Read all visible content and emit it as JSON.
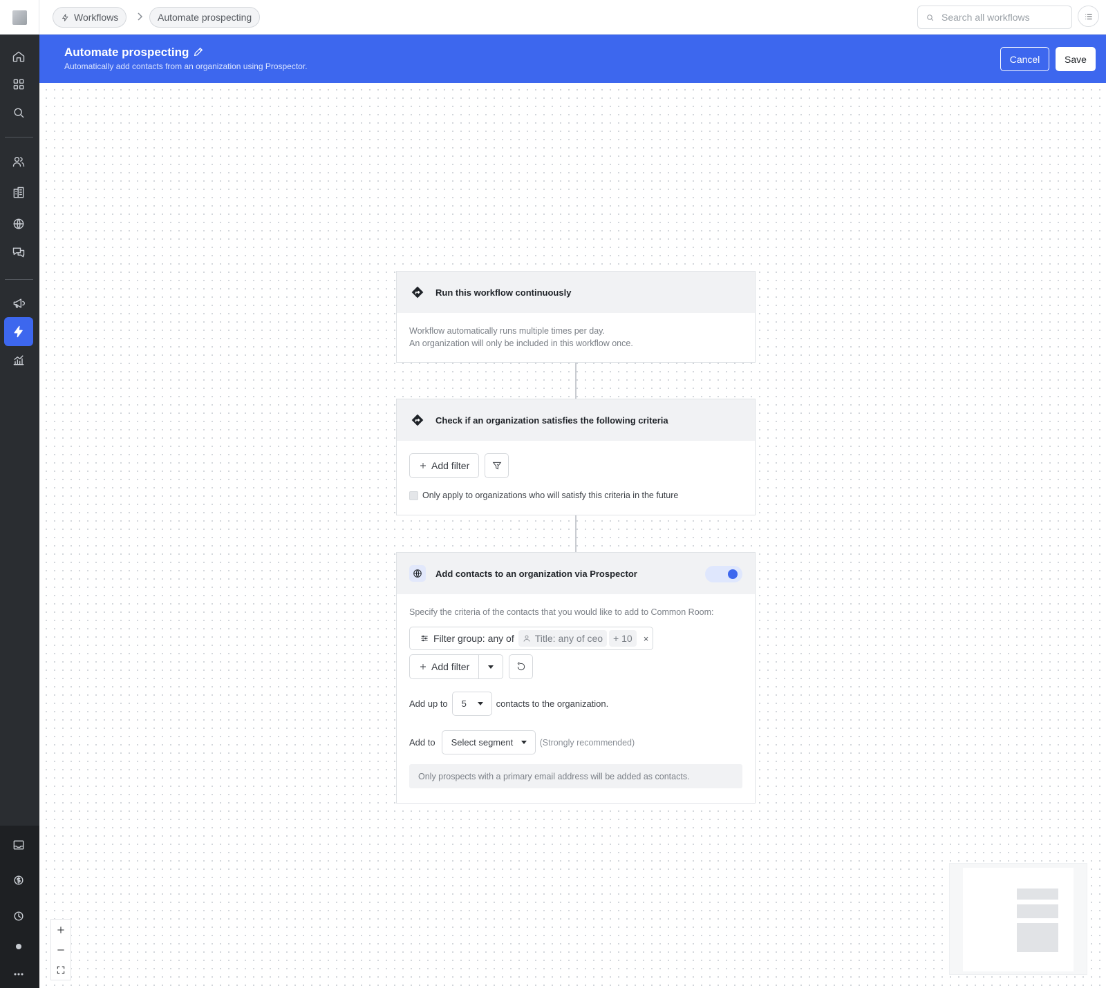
{
  "topbar": {
    "breadcrumbs": [
      {
        "label": "Workflows",
        "icon": "bolt-icon"
      },
      {
        "label": "Automate prospecting"
      }
    ],
    "search_placeholder": "Search all workflows"
  },
  "banner": {
    "title": "Automate prospecting",
    "subtitle": "Automatically add contacts from an organization using Prospector.",
    "cancel_label": "Cancel",
    "save_label": "Save"
  },
  "sidebar": {
    "items": [
      "home",
      "apps",
      "search",
      "contacts",
      "organizations",
      "web",
      "conversations",
      "campaigns",
      "workflows",
      "reports"
    ],
    "active": "workflows",
    "bottom_items": [
      "inbox",
      "billing",
      "recent",
      "status",
      "more"
    ]
  },
  "card1": {
    "title": "Run this workflow continuously",
    "line1": "Workflow automatically runs multiple times per day.",
    "line2": "An organization will only be included in this workflow once."
  },
  "card2": {
    "title": "Check if an organization satisfies the following criteria",
    "add_filter_label": "Add filter",
    "checkbox_label": "Only apply to organizations who will satisfy this criteria in the future"
  },
  "card3": {
    "title": "Add contacts to an organization via Prospector",
    "toggle_on": true,
    "description": "Specify the criteria of the contacts that you would like to add to Common Room:",
    "filter_group_label": "Filter group: any of",
    "filter_chip": "Title: any of ceo",
    "filter_more": "+ 10",
    "filter_remove": "×",
    "add_filter_label": "Add filter",
    "add_up_to_label": "Add up to",
    "count_value": "5",
    "contacts_suffix": "contacts to the organization.",
    "add_to_label": "Add to",
    "segment_placeholder": "Select segment",
    "recommended": "(Strongly recommended)",
    "note": "Only prospects with a primary email address will be added as contacts."
  },
  "colors": {
    "accent": "#3d67ee",
    "sidebar": "#2a2d31"
  }
}
